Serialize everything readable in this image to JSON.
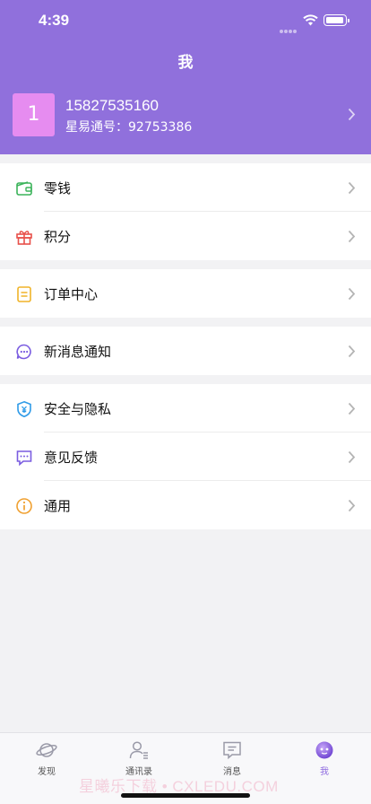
{
  "status_bar": {
    "time": "4:39"
  },
  "nav": {
    "title": "我"
  },
  "profile": {
    "avatar_text": "1",
    "phone": "15827535160",
    "account": "星易通号：92753386"
  },
  "menu": {
    "wallet": "零钱",
    "points": "积分",
    "orders": "订单中心",
    "notifications": "新消息通知",
    "security": "安全与隐私",
    "feedback": "意见反馈",
    "general": "通用"
  },
  "tabs": [
    {
      "label": "发现",
      "icon": "planet-icon"
    },
    {
      "label": "通讯录",
      "icon": "contacts-icon"
    },
    {
      "label": "消息",
      "icon": "message-icon"
    },
    {
      "label": "我",
      "icon": "me-icon",
      "active": true
    }
  ],
  "watermark": "星曦乐下载 • CXLEDU.COM",
  "colors": {
    "header": "#9070dc",
    "accent": "#8f6be0"
  }
}
